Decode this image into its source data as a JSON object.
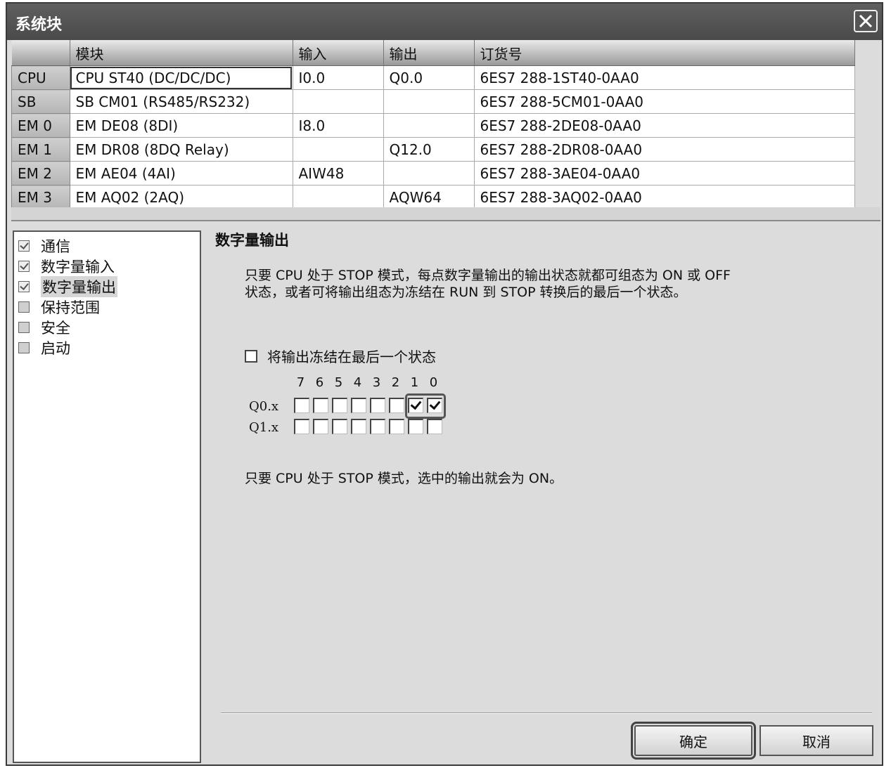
{
  "window": {
    "title": "系统块"
  },
  "grid": {
    "headers": {
      "rowhead": "",
      "module": "模块",
      "input": "输入",
      "output": "输出",
      "order": "订货号"
    },
    "rows": [
      {
        "slot": "CPU",
        "module": "CPU ST40 (DC/DC/DC)",
        "input": "I0.0",
        "output": "Q0.0",
        "order": "6ES7 288-1ST40-0AA0"
      },
      {
        "slot": "SB",
        "module": "SB CM01 (RS485/RS232)",
        "input": "",
        "output": "",
        "order": "6ES7 288-5CM01-0AA0"
      },
      {
        "slot": "EM 0",
        "module": "EM DE08 (8DI)",
        "input": "I8.0",
        "output": "",
        "order": "6ES7 288-2DE08-0AA0"
      },
      {
        "slot": "EM 1",
        "module": "EM DR08 (8DQ Relay)",
        "input": "",
        "output": "Q12.0",
        "order": "6ES7 288-2DR08-0AA0"
      },
      {
        "slot": "EM 2",
        "module": "EM AE04 (4AI)",
        "input": "AIW48",
        "output": "",
        "order": "6ES7 288-3AE04-0AA0"
      },
      {
        "slot": "EM 3",
        "module": "EM AQ02 (2AQ)",
        "input": "",
        "output": "AQW64",
        "order": "6ES7 288-3AQ02-0AA0"
      }
    ]
  },
  "tree": {
    "items": [
      {
        "label": "通信",
        "checked": true
      },
      {
        "label": "数字量输入",
        "checked": true
      },
      {
        "label": "数字量输出",
        "checked": true,
        "selected": true
      },
      {
        "label": "保持范围",
        "checked": false
      },
      {
        "label": "安全",
        "checked": false
      },
      {
        "label": "启动",
        "checked": false
      }
    ]
  },
  "panel": {
    "title": "数字量输出",
    "desc_line1": "只要 CPU 处于 STOP 模式，每点数字量输出的输出状态就都可组态为 ON 或 OFF",
    "desc_line2": "状态，或者可将输出组态为冻结在 RUN 到 STOP 转换后的最后一个状态。",
    "freeze_label": "将输出冻结在最后一个状态",
    "freeze_checked": false,
    "bit_numbers": [
      "7",
      "6",
      "5",
      "4",
      "3",
      "2",
      "1",
      "0"
    ],
    "rows": [
      {
        "label": "Q0.x",
        "bits": [
          false,
          false,
          false,
          false,
          false,
          false,
          true,
          true
        ]
      },
      {
        "label": "Q1.x",
        "bits": [
          false,
          false,
          false,
          false,
          false,
          false,
          false,
          false
        ]
      }
    ],
    "note": "只要 CPU 处于 STOP 模式，选中的输出就会为 ON。"
  },
  "buttons": {
    "ok": "确定",
    "cancel": "取消"
  }
}
